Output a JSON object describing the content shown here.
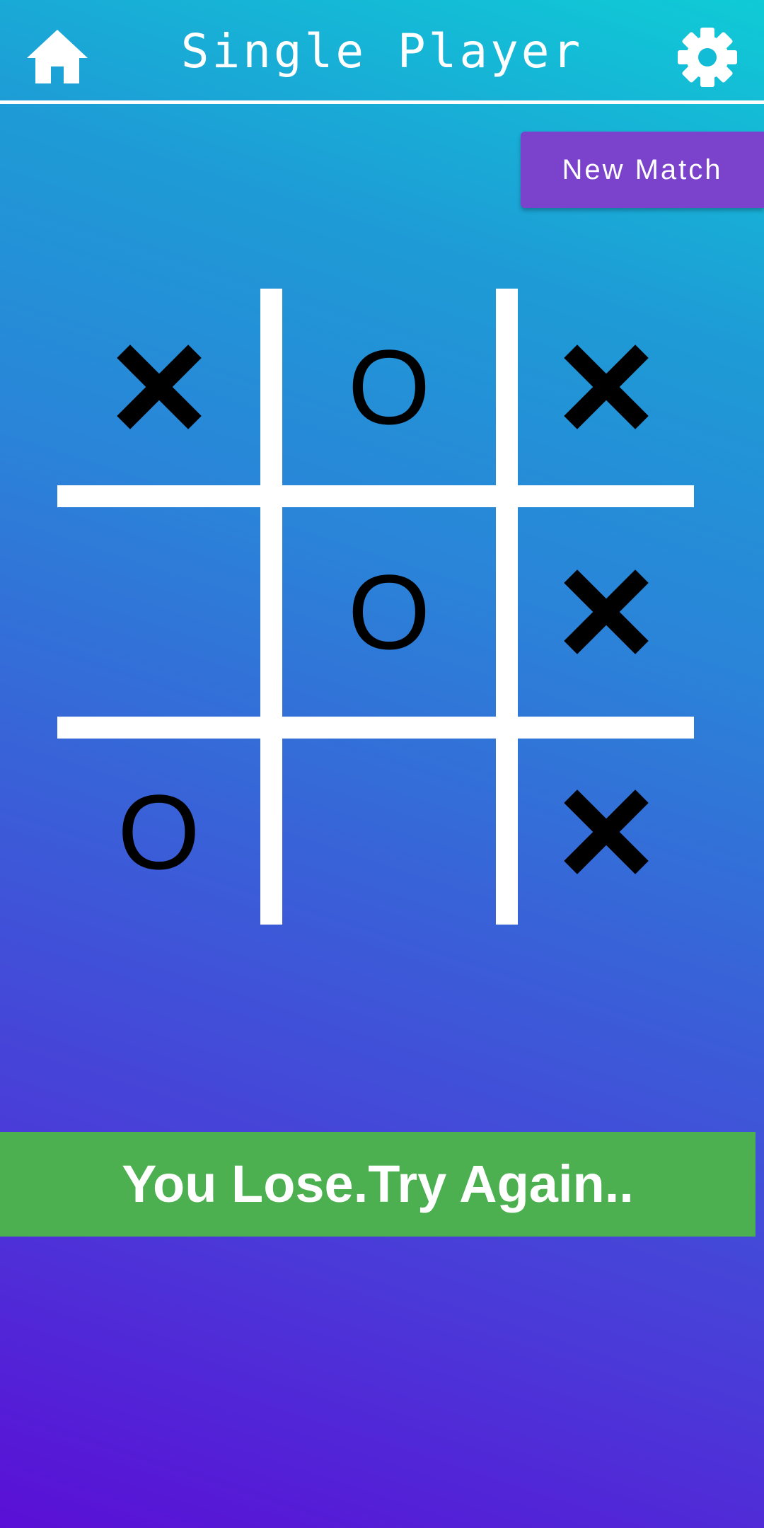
{
  "header": {
    "title": "Single Player",
    "home_icon": "home-icon",
    "settings_icon": "gear-icon"
  },
  "actions": {
    "new_match_label": "New Match"
  },
  "board": {
    "cells": [
      "X",
      "O",
      "X",
      "",
      "O",
      "X",
      "O",
      "",
      "X"
    ]
  },
  "result": {
    "message": "You Lose.Try Again.."
  },
  "colors": {
    "gradient_top": "#0fcbd6",
    "gradient_bottom": "#5a0fd6",
    "new_match_button": "#7b42cc",
    "result_banner": "#4caf50",
    "marks": "#000000",
    "grid": "#ffffff"
  }
}
